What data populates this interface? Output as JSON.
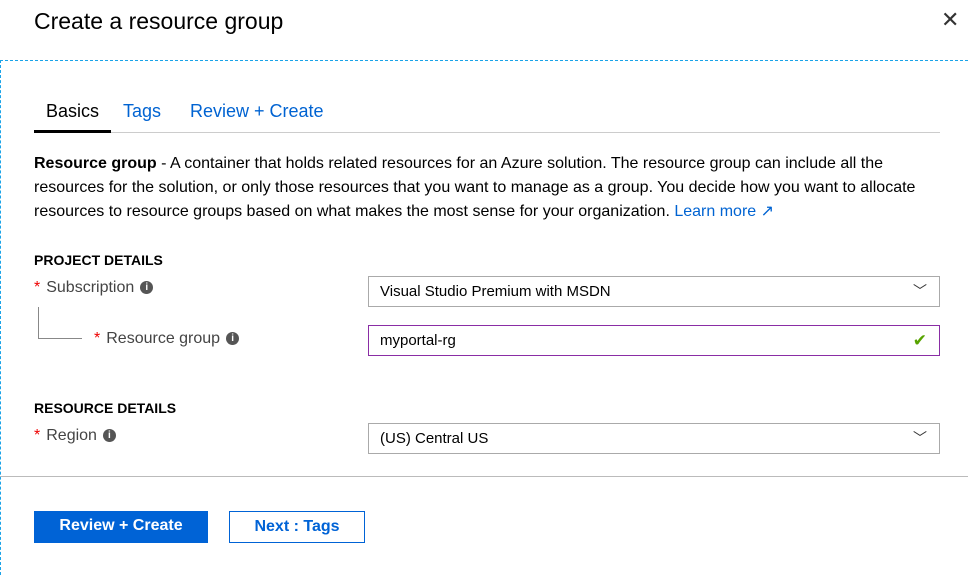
{
  "header": {
    "title": "Create a resource group",
    "close_icon": "close-icon"
  },
  "tabs": [
    {
      "label": "Basics",
      "active": true
    },
    {
      "label": "Tags"
    },
    {
      "label": "Review + Create"
    }
  ],
  "description": {
    "bold": "Resource group",
    "text": " - A container that holds related resources for an Azure solution. The resource group can include all the resources for the solution, or only those resources that you want to manage as a group. You decide how you want to allocate resources to resource groups based on what makes the most sense for your organization. ",
    "link": "Learn more",
    "link_icon": "external-link-icon"
  },
  "project": {
    "heading": "PROJECT DETAILS",
    "subscription": {
      "label": "Subscription",
      "required": "*",
      "value": "Visual Studio Premium with MSDN"
    },
    "resource_group": {
      "label": "Resource group",
      "required": "*",
      "value": "myportal-rg",
      "valid": true
    }
  },
  "resource": {
    "heading": "RESOURCE DETAILS",
    "region": {
      "label": "Region",
      "required": "*",
      "value": "(US) Central US"
    }
  },
  "footer": {
    "primary": "Review + Create",
    "secondary": "Next : Tags"
  },
  "colors": {
    "accent": "#0063d6",
    "focus_border": "#8a2da5",
    "valid": "#57a300",
    "required": "#e00000"
  }
}
